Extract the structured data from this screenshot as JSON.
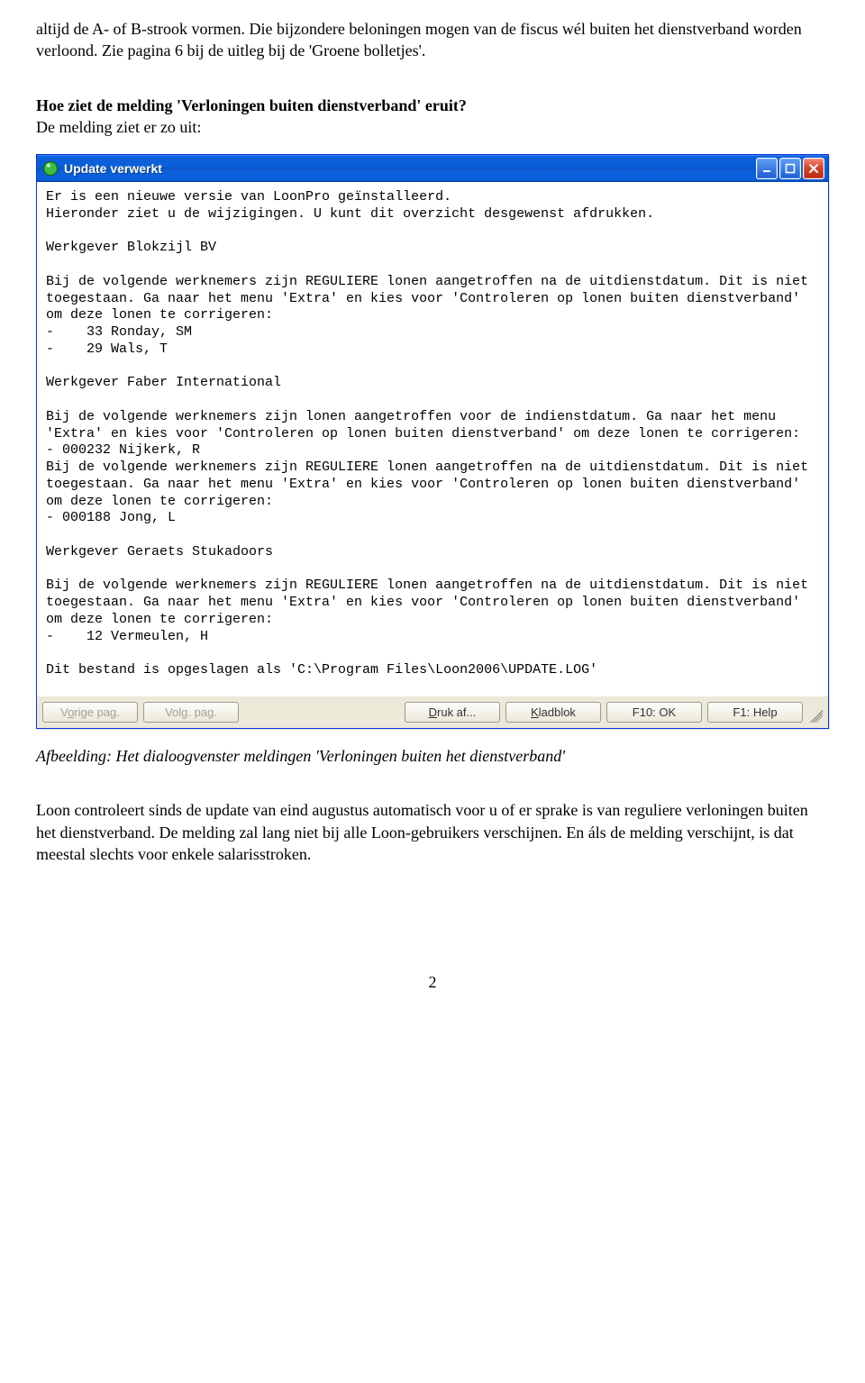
{
  "intro": {
    "p1": "altijd de A- of B-strook vormen. Die bijzondere beloningen mogen van de fiscus wél buiten het dienstverband worden verloond. Zie pagina 6 bij de uitleg bij de 'Groene bolletjes'.",
    "q_bold": "Hoe ziet de melding 'Verloningen buiten dienstverband' eruit?",
    "a_line": "De melding ziet er zo uit:"
  },
  "dialog": {
    "title": "Update verwerkt",
    "body": "Er is een nieuwe versie van LoonPro geïnstalleerd.\nHieronder ziet u de wijzigingen. U kunt dit overzicht desgewenst afdrukken.\n\nWerkgever Blokzijl BV\n\nBij de volgende werknemers zijn REGULIERE lonen aangetroffen na de uitdienstdatum. Dit is niet toegestaan. Ga naar het menu 'Extra' en kies voor 'Controleren op lonen buiten dienstverband' om deze lonen te corrigeren:\n-    33 Ronday, SM\n-    29 Wals, T\n\nWerkgever Faber International\n\nBij de volgende werknemers zijn lonen aangetroffen voor de indienstdatum. Ga naar het menu 'Extra' en kies voor 'Controleren op lonen buiten dienstverband' om deze lonen te corrigeren:\n- 000232 Nijkerk, R\nBij de volgende werknemers zijn REGULIERE lonen aangetroffen na de uitdienstdatum. Dit is niet toegestaan. Ga naar het menu 'Extra' en kies voor 'Controleren op lonen buiten dienstverband' om deze lonen te corrigeren:\n- 000188 Jong, L\n\nWerkgever Geraets Stukadoors\n\nBij de volgende werknemers zijn REGULIERE lonen aangetroffen na de uitdienstdatum. Dit is niet toegestaan. Ga naar het menu 'Extra' en kies voor 'Controleren op lonen buiten dienstverband' om deze lonen te corrigeren:\n-    12 Vermeulen, H\n\nDit bestand is opgeslagen als 'C:\\Program Files\\Loon2006\\UPDATE.LOG'",
    "buttons": {
      "prev": "Vorige pag.",
      "next": "Volg. pag.",
      "print": "Druk af...",
      "notepad": "Kladblok",
      "ok": "F10: OK",
      "help": "F1: Help"
    }
  },
  "caption": "Afbeelding: Het dialoogvenster meldingen 'Verloningen buiten het dienstverband'",
  "outro": "Loon controleert sinds de update van eind augustus automatisch voor u of er sprake is van reguliere verloningen buiten het dienstverband. De melding zal lang niet bij alle Loon-gebruikers verschijnen. En áls de melding verschijnt, is dat meestal slechts voor enkele salarisstroken.",
  "page_number": "2"
}
